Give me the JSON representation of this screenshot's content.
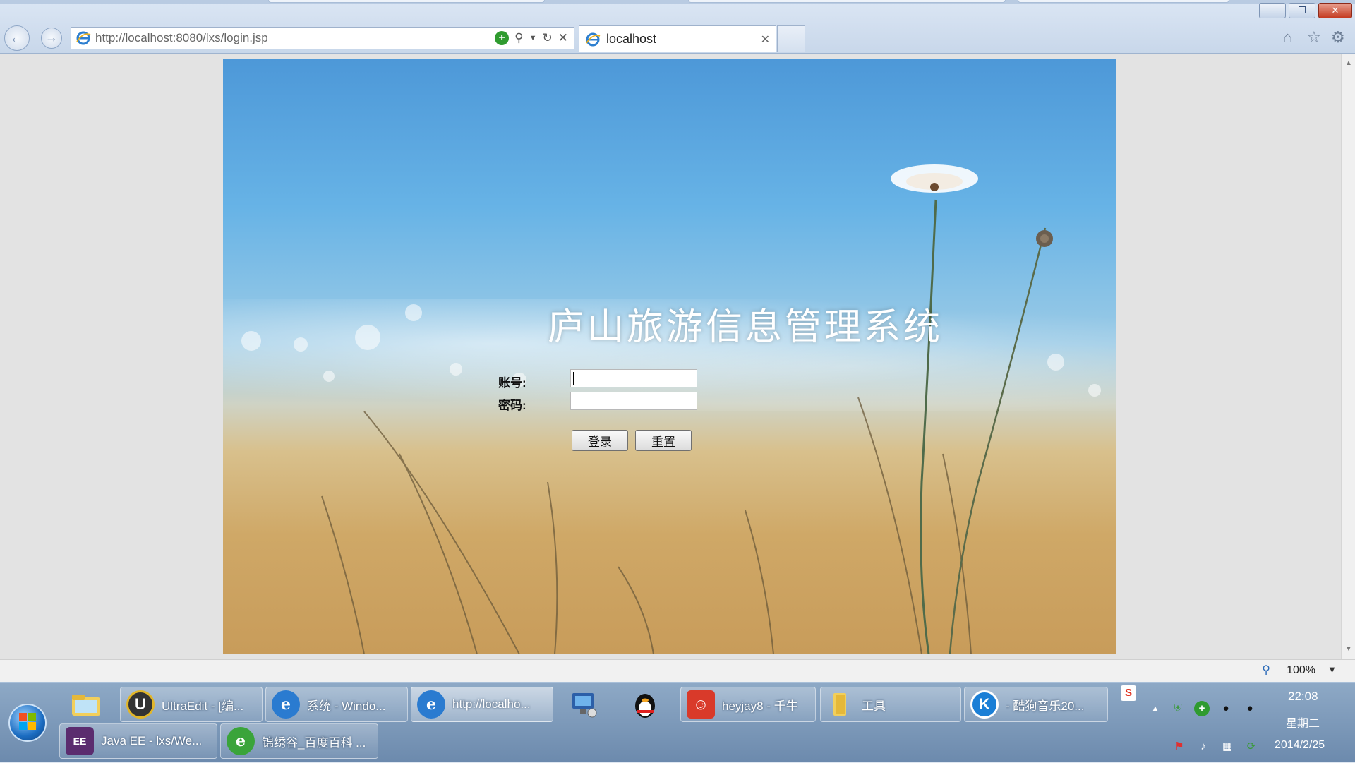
{
  "browser": {
    "address": "http://localhost:8080/lxs/login.jsp",
    "tab_title": "localhost",
    "close_glyph": "✕",
    "zoom": "100%"
  },
  "page": {
    "title": "庐山旅游信息管理系统",
    "account_label": "账号:",
    "password_label": "密码:",
    "account_value": "",
    "password_value": "",
    "login_button": "登录",
    "reset_button": "重置"
  },
  "taskbar": {
    "items": [
      {
        "label": "UltraEdit - [编..."
      },
      {
        "label": "系统 - Windo..."
      },
      {
        "label": "http://localho..."
      },
      {
        "label": "heyjay8 - 千牛"
      },
      {
        "label": "工具"
      },
      {
        "label": "- 酷狗音乐20..."
      },
      {
        "label": "Java EE - lxs/We..."
      },
      {
        "label": "锦绣谷_百度百科 ..."
      }
    ],
    "icon_labels": {
      "ultraedit": "U",
      "kugou": "K",
      "javaee": "EE",
      "ime": "S"
    }
  },
  "clock": {
    "time": "22:08",
    "weekday": "星期二",
    "date": "2014/2/25"
  },
  "colors": {
    "sky": "#5ca6de",
    "grass": "#cfa867",
    "title_text": "#ffffff"
  }
}
